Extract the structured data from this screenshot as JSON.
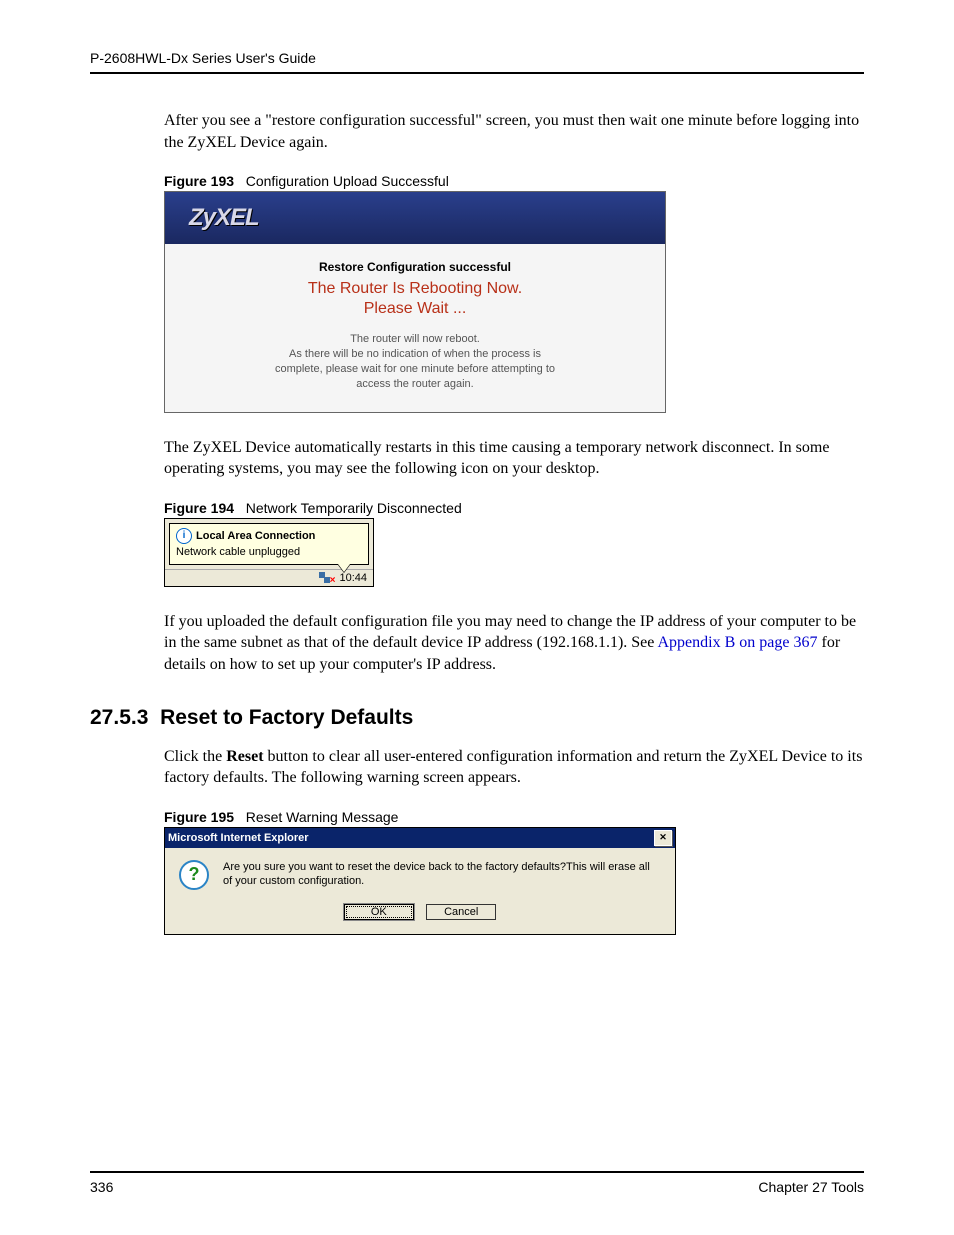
{
  "header": {
    "guide_title": "P-2608HWL-Dx Series User's Guide"
  },
  "body": {
    "para1": "After you see a \"restore configuration successful\" screen, you must then wait one minute before logging into the ZyXEL Device again.",
    "fig193_label": "Figure 193",
    "fig193_title": "Configuration Upload Successful",
    "fig193": {
      "logo": "ZyXEL",
      "heading": "Restore Configuration successful",
      "reboot_line1": "The Router Is Rebooting Now.",
      "reboot_line2": "Please Wait ...",
      "msg_line1": "The router will now reboot.",
      "msg_line2": "As there will be no indication of when the process is",
      "msg_line3": "complete, please wait for one minute before attempting to",
      "msg_line4": "access the router again."
    },
    "para2": "The ZyXEL Device automatically restarts in this time causing a temporary network disconnect. In some operating systems, you may see the following icon on your desktop.",
    "fig194_label": "Figure 194",
    "fig194_title": "Network Temporarily Disconnected",
    "fig194": {
      "balloon_title": "Local Area Connection",
      "balloon_text": "Network cable unplugged",
      "tray_time": "10:44"
    },
    "para3_part1": "If you uploaded the default configuration file you may need to change the IP address of your computer to be in the same subnet as that of the default device IP address (192.168.1.1). See ",
    "para3_link": "Appendix B on page 367",
    "para3_part2": " for details on how to set up your computer's IP address.",
    "section_num": "27.5.3",
    "section_title": "Reset to Factory Defaults",
    "para4_part1": "Click the ",
    "para4_bold": "Reset",
    "para4_part2": " button to clear all user-entered configuration information and return the ZyXEL Device to its factory defaults. The following warning screen appears.",
    "fig195_label": "Figure 195",
    "fig195_title": "Reset Warning Message",
    "fig195": {
      "titlebar": "Microsoft Internet Explorer",
      "message": "Are you sure you want to reset the device back to the factory defaults?This will erase all of your custom configuration.",
      "ok": "OK",
      "cancel": "Cancel"
    }
  },
  "footer": {
    "page": "336",
    "chapter": "Chapter 27 Tools"
  }
}
